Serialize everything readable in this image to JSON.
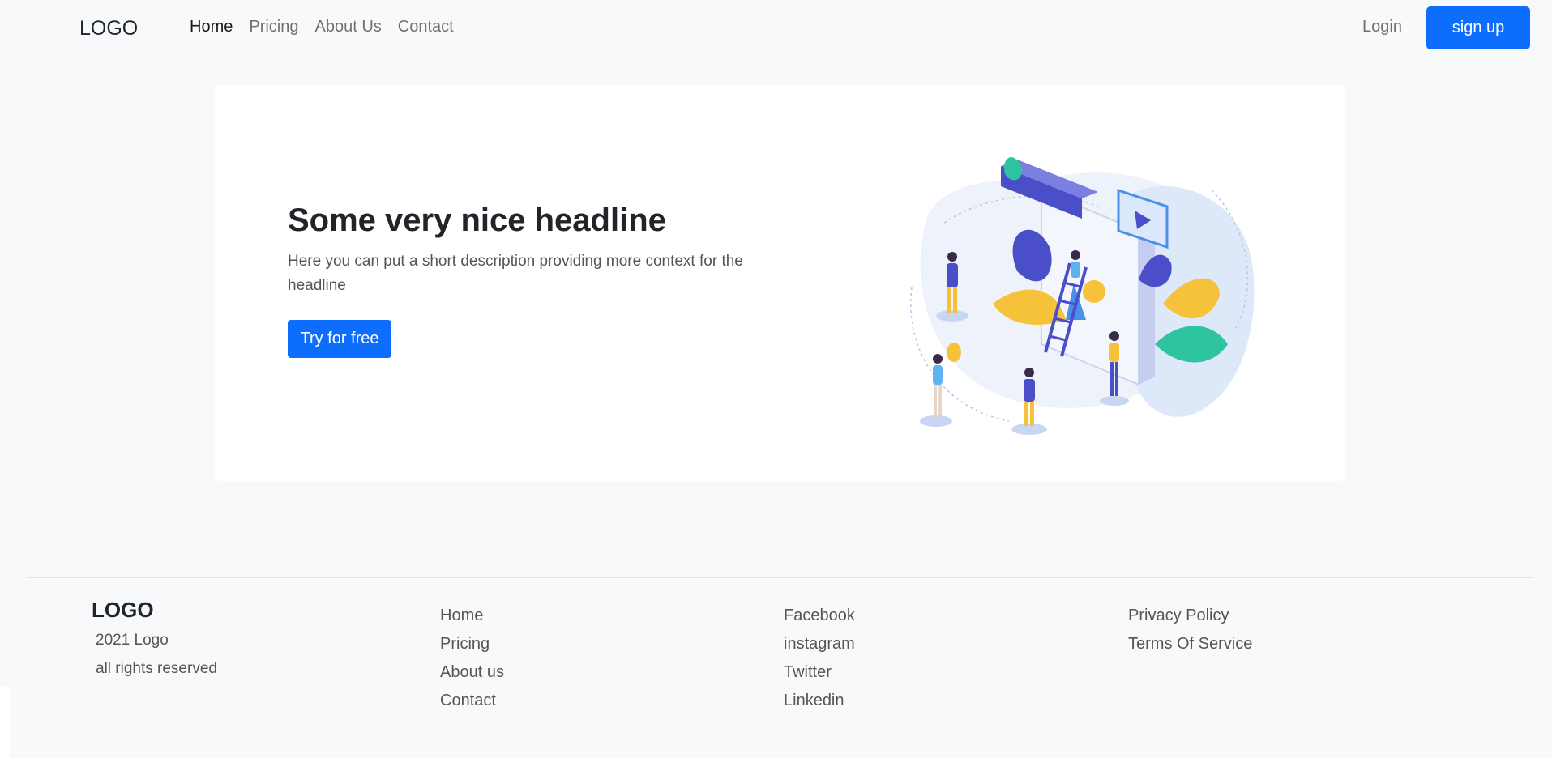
{
  "nav": {
    "logo": "LOGO",
    "links": [
      "Home",
      "Pricing",
      "About Us",
      "Contact"
    ],
    "login": "Login",
    "signup": "sign up"
  },
  "hero": {
    "headline": "Some very nice headline",
    "description": "Here you can put a short description providing more context for the headline",
    "cta": "Try for free"
  },
  "footer": {
    "logo": "LOGO",
    "copyright": "2021 Logo",
    "rights": "all rights reserved",
    "nav_links": [
      "Home",
      "Pricing",
      "About us",
      "Contact"
    ],
    "social_links": [
      "Facebook",
      "instagram",
      "Twitter",
      "Linkedin"
    ],
    "legal_links": [
      "Privacy Policy",
      "Terms Of Service"
    ]
  },
  "colors": {
    "primary": "#0d6efd",
    "background": "#f8f9fa",
    "card": "#ffffff",
    "illustration_blue": "#4a4fc9",
    "illustration_yellow": "#f5c23a",
    "illustration_teal": "#2ec4a0"
  }
}
